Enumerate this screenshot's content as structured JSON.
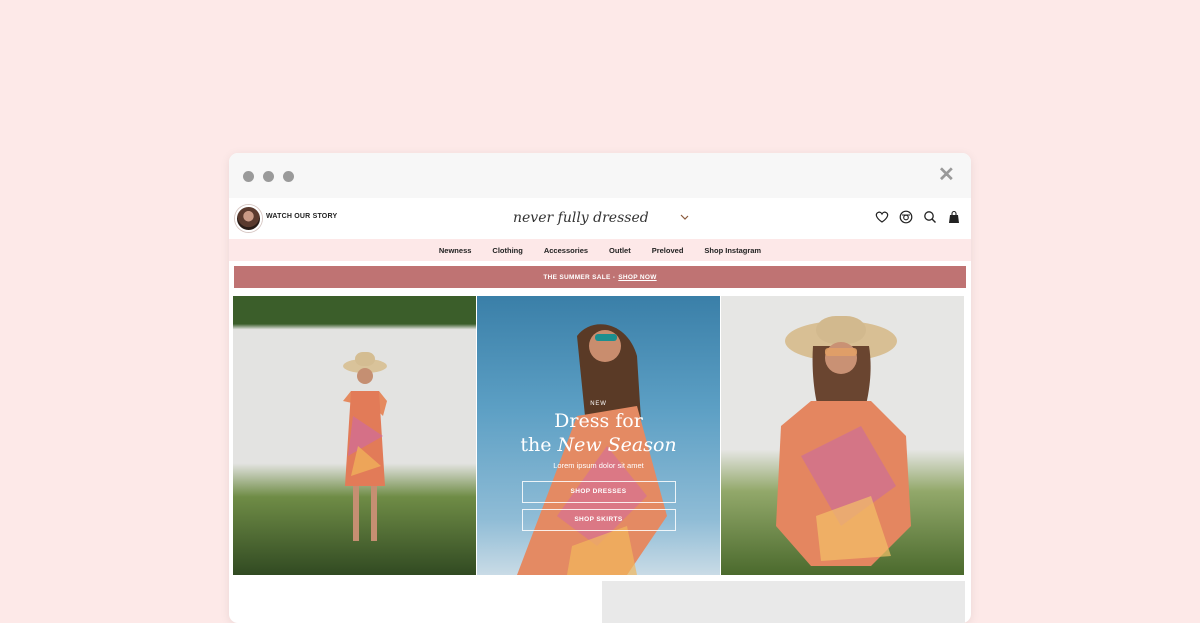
{
  "header": {
    "story_link": "WATCH OUR STORY",
    "logo_text": "never fully dressed"
  },
  "nav": [
    "Newness",
    "Clothing",
    "Accessories",
    "Outlet",
    "Preloved",
    "Shop Instagram"
  ],
  "promo": {
    "text": "THE SUMMER SALE - ",
    "link": "SHOP NOW"
  },
  "hero": {
    "kicker": "NEW",
    "title_line1": "Dress for",
    "title_line2_plain": "the ",
    "title_line2_italic": "New Season",
    "subtitle": "Lorem ipsum dolor sit amet",
    "button1": "SHOP DRESSES",
    "button2": "SHOP SKIRTS"
  },
  "colors": {
    "page_bg": "#fde9e8",
    "nav_bg": "#fde8e8",
    "promo_bg": "#bf7373"
  },
  "icons": [
    "heart-icon",
    "instagram-icon",
    "search-icon",
    "bag-icon",
    "close-icon"
  ]
}
